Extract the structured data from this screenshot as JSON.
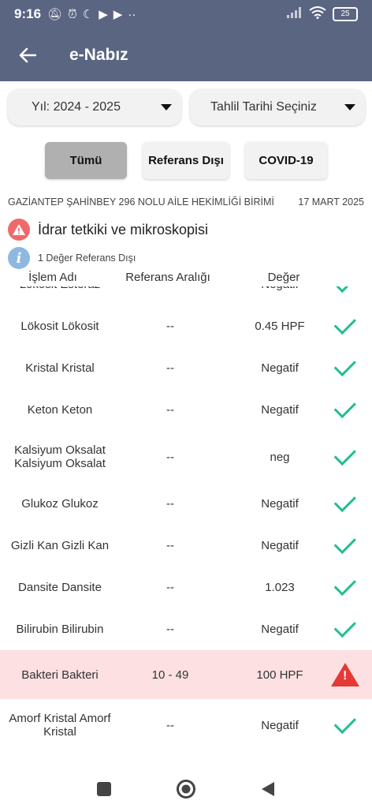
{
  "status": {
    "time": "9:16",
    "battery": "25"
  },
  "app_bar": {
    "title": "e-Nabız"
  },
  "filters": {
    "year": "Yıl: 2024 - 2025",
    "date": "Tahlil Tarihi Seçiniz"
  },
  "tabs": [
    {
      "label": "Tümü",
      "active": true
    },
    {
      "label": "Referans Dışı",
      "active": false
    },
    {
      "label": "COVID-19",
      "active": false
    }
  ],
  "clinic": {
    "name": "GAZİANTEP ŞAHİNBEY 296 NOLU AİLE HEKİMLİĞİ BİRİMİ",
    "date": "17 MART 2025"
  },
  "test": {
    "title": "İdrar tetkiki ve mikroskopisi",
    "info": "1 Değer Referans Dışı"
  },
  "columns": {
    "name": "İşlem Adı",
    "range": "Referans Aralığı",
    "value": "Değer"
  },
  "rows": [
    {
      "name": "Lökosit Esteraz",
      "range": "--",
      "value": "Negatif",
      "status": "ok"
    },
    {
      "name": "Lökosit Lökosit",
      "range": "--",
      "value": "0.45 HPF",
      "status": "ok"
    },
    {
      "name": "Kristal Kristal",
      "range": "--",
      "value": "Negatif",
      "status": "ok"
    },
    {
      "name": "Keton Keton",
      "range": "--",
      "value": "Negatif",
      "status": "ok"
    },
    {
      "name": "Kalsiyum Oksalat Kalsiyum Oksalat",
      "range": "--",
      "value": "neg",
      "status": "ok"
    },
    {
      "name": "Glukoz Glukoz",
      "range": "--",
      "value": "Negatif",
      "status": "ok"
    },
    {
      "name": "Gizli Kan Gizli Kan",
      "range": "--",
      "value": "Negatif",
      "status": "ok"
    },
    {
      "name": "Dansite Dansite",
      "range": "--",
      "value": "1.023",
      "status": "ok"
    },
    {
      "name": "Bilirubin Bilirubin",
      "range": "--",
      "value": "Negatif",
      "status": "ok"
    },
    {
      "name": "Bakteri Bakteri",
      "range": "10 - 49",
      "value": "100 HPF",
      "status": "alert"
    },
    {
      "name": "Amorf Kristal Amorf Kristal",
      "range": "--",
      "value": "Negatif",
      "status": "ok"
    }
  ]
}
